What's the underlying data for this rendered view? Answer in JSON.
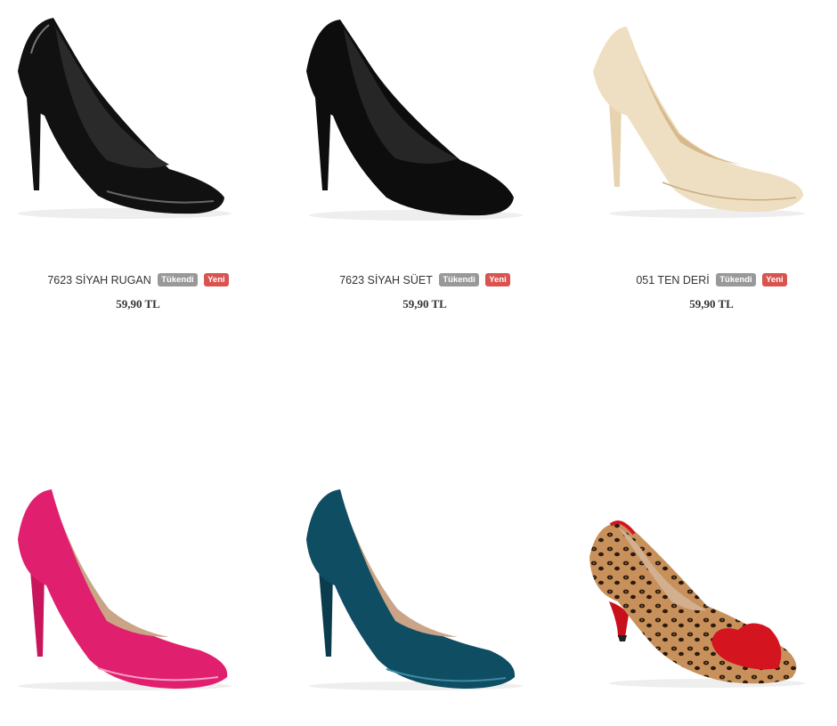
{
  "products": [
    {
      "name": "7623 SİYAH RUGAN",
      "sold_out_label": "Tükendi",
      "new_label": "Yeni",
      "price": "59,90 TL",
      "shoe_color": "#111111",
      "lining_color": "#2a2a2a",
      "pattern": "patent"
    },
    {
      "name": "7623 SİYAH SÜET",
      "sold_out_label": "Tükendi",
      "new_label": "Yeni",
      "price": "59,90 TL",
      "shoe_color": "#0d0d0d",
      "lining_color": "#262626",
      "pattern": "suede"
    },
    {
      "name": "051 TEN DERİ",
      "sold_out_label": "Tükendi",
      "new_label": "Yeni",
      "price": "59,90 TL",
      "shoe_color": "#efdfc2",
      "lining_color": "#d8b98c",
      "pattern": "leather"
    },
    {
      "shoe_color": "#e0206e",
      "lining_color": "#c9a487",
      "pattern": "patent"
    },
    {
      "shoe_color": "#0f4d63",
      "lining_color": "#c9a487",
      "pattern": "patent"
    },
    {
      "shoe_color": "#c8905a",
      "lining_color": "#d2b08f",
      "accent_color": "#d4141f",
      "pattern": "leopard"
    }
  ]
}
